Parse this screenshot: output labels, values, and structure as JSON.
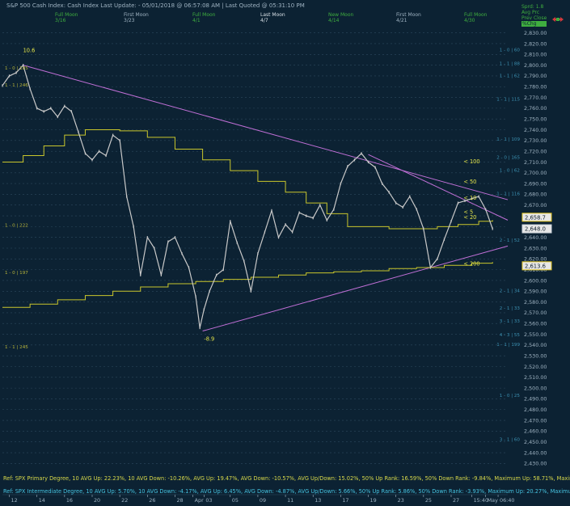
{
  "header": {
    "title": "S&P 500 Cash Index:  Cash Index  Last Update: - 05/01/2018 @ 06:57:08 AM | Last Quoted @ 05:31:10 PM",
    "corner": {
      "line1": "Sprd: 1.8",
      "line2": "Avg Prc",
      "line3": "Prev Close",
      "line4": "%Chg"
    }
  },
  "moon_phases": [
    {
      "label": "Full Moon",
      "date": "3/16",
      "color": "#3fae3f"
    },
    {
      "label": "First Moon",
      "date": "3/23",
      "color": "#9fb3c2"
    },
    {
      "label": "Full Moon",
      "date": "4/1",
      "color": "#3fae3f"
    },
    {
      "label": "Last Moon",
      "date": "4/7",
      "color": "#d8e0e6"
    },
    {
      "label": "New Moon",
      "date": "4/14",
      "color": "#3fae3f"
    },
    {
      "label": "First Moon",
      "date": "4/21",
      "color": "#9fb3c2"
    },
    {
      "label": "Full Moon",
      "date": "4/30",
      "color": "#3fae3f"
    }
  ],
  "chart_data": {
    "type": "line",
    "title": "S&P 500 Cash Index",
    "y_axis": {
      "ylim": [
        2425,
        2835
      ],
      "ticks": [
        "2,830.00",
        "2,820.00",
        "2,810.00",
        "2,800.00",
        "2,790.00",
        "2,780.00",
        "2,770.00",
        "2,760.00",
        "2,750.00",
        "2,740.00",
        "2,730.00",
        "2,720.00",
        "2,710.00",
        "2,700.00",
        "2,690.00",
        "2,680.00",
        "2,670.00",
        "2,660.00",
        "2,650.00",
        "2,640.00",
        "2,630.00",
        "2,620.00",
        "2,610.00",
        "2,600.00",
        "2,590.00",
        "2,580.00",
        "2,570.00",
        "2,560.00",
        "2,550.00",
        "2,540.00",
        "2,530.00",
        "2,520.00",
        "2,510.00",
        "2,500.00",
        "2,490.00",
        "2,480.00",
        "2,470.00",
        "2,460.00",
        "2,450.00",
        "2,440.00",
        "2,430.00"
      ]
    },
    "x_axis": {
      "ticks": [
        {
          "label": "12",
          "x": 0.5
        },
        {
          "label": "14",
          "x": 2.5
        },
        {
          "label": "16",
          "x": 4.5
        },
        {
          "label": "20",
          "x": 6.5
        },
        {
          "label": "22",
          "x": 8.5
        },
        {
          "label": "26",
          "x": 10.5
        },
        {
          "label": "28",
          "x": 12.5
        },
        {
          "label": "Apr",
          "x": 13.8
        },
        {
          "label": "03",
          "x": 14.6
        },
        {
          "label": "05",
          "x": 16.5
        },
        {
          "label": "09",
          "x": 18.5
        },
        {
          "label": "11",
          "x": 20.5
        },
        {
          "label": "13",
          "x": 22.5
        },
        {
          "label": "17",
          "x": 24.5
        },
        {
          "label": "19",
          "x": 26.5
        },
        {
          "label": "23",
          "x": 28.5
        },
        {
          "label": "25",
          "x": 30.5
        },
        {
          "label": "27",
          "x": 32.5
        },
        {
          "label": "15:40",
          "x": 34.0
        },
        {
          "label": "May",
          "x": 35.0
        },
        {
          "label": "06:40",
          "x": 35.9
        }
      ],
      "xlim": [
        0,
        36.6
      ]
    },
    "price_series": [
      [
        0.0,
        2781
      ],
      [
        0.5,
        2790
      ],
      [
        1.0,
        2793
      ],
      [
        1.5,
        2800
      ],
      [
        2.0,
        2778
      ],
      [
        2.5,
        2760
      ],
      [
        3.0,
        2757
      ],
      [
        3.5,
        2760
      ],
      [
        4.0,
        2752
      ],
      [
        4.5,
        2762
      ],
      [
        5.0,
        2757
      ],
      [
        5.5,
        2738
      ],
      [
        6.0,
        2718
      ],
      [
        6.5,
        2712
      ],
      [
        7.0,
        2720
      ],
      [
        7.5,
        2716
      ],
      [
        8.0,
        2735
      ],
      [
        8.5,
        2730
      ],
      [
        9.0,
        2678
      ],
      [
        9.5,
        2650
      ],
      [
        10.0,
        2605
      ],
      [
        10.5,
        2640
      ],
      [
        11.0,
        2630
      ],
      [
        11.5,
        2605
      ],
      [
        12.0,
        2636
      ],
      [
        12.5,
        2640
      ],
      [
        13.0,
        2625
      ],
      [
        13.5,
        2612
      ],
      [
        14.0,
        2585
      ],
      [
        14.3,
        2556
      ],
      [
        14.6,
        2573
      ],
      [
        15.0,
        2590
      ],
      [
        15.5,
        2605
      ],
      [
        16.0,
        2610
      ],
      [
        16.5,
        2655
      ],
      [
        17.0,
        2635
      ],
      [
        17.5,
        2618
      ],
      [
        18.0,
        2590
      ],
      [
        18.5,
        2625
      ],
      [
        19.0,
        2645
      ],
      [
        19.5,
        2665
      ],
      [
        20.0,
        2640
      ],
      [
        20.5,
        2652
      ],
      [
        21.0,
        2645
      ],
      [
        21.5,
        2663
      ],
      [
        22.0,
        2660
      ],
      [
        22.5,
        2658
      ],
      [
        23.0,
        2670
      ],
      [
        23.5,
        2656
      ],
      [
        24.0,
        2666
      ],
      [
        24.5,
        2690
      ],
      [
        25.0,
        2706
      ],
      [
        25.5,
        2712
      ],
      [
        26.0,
        2718
      ],
      [
        26.5,
        2710
      ],
      [
        27.0,
        2705
      ],
      [
        27.5,
        2690
      ],
      [
        28.0,
        2682
      ],
      [
        28.5,
        2672
      ],
      [
        29.0,
        2668
      ],
      [
        29.5,
        2678
      ],
      [
        30.0,
        2666
      ],
      [
        30.5,
        2648
      ],
      [
        31.0,
        2612
      ],
      [
        31.5,
        2620
      ],
      [
        32.0,
        2638
      ],
      [
        32.5,
        2655
      ],
      [
        33.0,
        2672
      ],
      [
        33.5,
        2674
      ],
      [
        34.0,
        2676
      ],
      [
        34.5,
        2678
      ],
      [
        35.0,
        2666
      ],
      [
        35.5,
        2648
      ]
    ],
    "overlays": [
      {
        "name": "upper_trend",
        "color": "#c06fd6",
        "points": [
          [
            1.5,
            2800
          ],
          [
            36.6,
            2675
          ]
        ]
      },
      {
        "name": "lower_trend",
        "color": "#c06fd6",
        "points": [
          [
            14.5,
            2553
          ],
          [
            36.6,
            2632
          ]
        ]
      },
      {
        "name": "inner_trend",
        "color": "#c06fd6",
        "points": [
          [
            26.5,
            2717
          ],
          [
            36.6,
            2656
          ]
        ]
      },
      {
        "name": "ma_step_1",
        "color": "#c9c62c",
        "points": [
          [
            0,
            2710
          ],
          [
            1.5,
            2716
          ],
          [
            3.0,
            2725
          ],
          [
            4.5,
            2735
          ],
          [
            6.0,
            2740
          ],
          [
            8.5,
            2739
          ],
          [
            10.5,
            2733
          ],
          [
            12.5,
            2722
          ],
          [
            14.5,
            2712
          ],
          [
            16.5,
            2702
          ],
          [
            18.5,
            2692
          ],
          [
            20.5,
            2682
          ],
          [
            22.0,
            2672
          ],
          [
            23.5,
            2662
          ],
          [
            25.0,
            2650
          ],
          [
            28.0,
            2648
          ],
          [
            30.0,
            2648
          ],
          [
            31.5,
            2650
          ],
          [
            33.0,
            2652
          ],
          [
            34.5,
            2655
          ],
          [
            35.5,
            2656
          ]
        ]
      },
      {
        "name": "ma_step_2",
        "color": "#c9c62c",
        "points": [
          [
            0,
            2575
          ],
          [
            2.0,
            2578
          ],
          [
            4.0,
            2582
          ],
          [
            6.0,
            2586
          ],
          [
            8.0,
            2590
          ],
          [
            10.0,
            2594
          ],
          [
            12.0,
            2597
          ],
          [
            14.0,
            2599
          ],
          [
            16.0,
            2601
          ],
          [
            18.0,
            2603
          ],
          [
            20.0,
            2605
          ],
          [
            22.0,
            2607
          ],
          [
            24.0,
            2608
          ],
          [
            26.0,
            2609
          ],
          [
            28.0,
            2611
          ],
          [
            30.0,
            2612
          ],
          [
            32.0,
            2614
          ],
          [
            34.0,
            2616
          ],
          [
            35.5,
            2617
          ]
        ]
      }
    ],
    "annotations": [
      {
        "text": "10.6",
        "x": 1.5,
        "y": 2812,
        "color": "#e8e84a"
      },
      {
        "text": "-8.9",
        "x": 14.6,
        "y": 2544,
        "color": "#e8e84a"
      },
      {
        "text": "< 100",
        "x": 33.4,
        "y": 2709,
        "color": "#e8e84a"
      },
      {
        "text": "< 50",
        "x": 33.4,
        "y": 2690,
        "color": "#e8e84a"
      },
      {
        "text": "< 10",
        "x": 33.4,
        "y": 2675,
        "color": "#e8e84a"
      },
      {
        "text": "< 5",
        "x": 33.4,
        "y": 2662,
        "color": "#e8e84a"
      },
      {
        "text": "< 20",
        "x": 33.4,
        "y": 2657,
        "color": "#e8e84a"
      },
      {
        "text": "< 200",
        "x": 33.4,
        "y": 2614,
        "color": "#e8e84a"
      }
    ],
    "level_labels_left": [
      {
        "text": "1 - 0 | 185",
        "y": 2796
      },
      {
        "text": "1 - 1 | 246",
        "y": 2780
      },
      {
        "text": "1 - 0 | 222",
        "y": 2650
      },
      {
        "text": "1 - 0 | 197",
        "y": 2606
      },
      {
        "text": "1 - 1 | 245",
        "y": 2537
      }
    ],
    "level_labels_right": [
      {
        "text": "1 - 0 | 60",
        "y": 2813
      },
      {
        "text": "1 - 1 | 88",
        "y": 2800
      },
      {
        "text": "1 - 1 | 62",
        "y": 2789
      },
      {
        "text": "1 - 1 | 115",
        "y": 2767
      },
      {
        "text": "1 - 1 | 109",
        "y": 2730
      },
      {
        "text": "2 - 0 | 165",
        "y": 2713
      },
      {
        "text": "1 - 0 | 62",
        "y": 2701
      },
      {
        "text": "1 - 1 | 116",
        "y": 2679
      },
      {
        "text": "2 - 1 | 52",
        "y": 2636
      },
      {
        "text": "2 - 1 | 34",
        "y": 2589
      },
      {
        "text": "2 - 1 | 33",
        "y": 2573
      },
      {
        "text": "3 - 1 | 33",
        "y": 2561
      },
      {
        "text": "4 - 3 | 55",
        "y": 2548
      },
      {
        "text": "1 - 1 | 199",
        "y": 2539
      },
      {
        "text": "1 - 0 | 25",
        "y": 2492
      },
      {
        "text": "3 - 1 | 60",
        "y": 2451
      }
    ],
    "price_tags": [
      {
        "text": "2,658.7",
        "y": 2658.7,
        "color": "#e3c623"
      },
      {
        "text": "2,648.0",
        "y": 2648.0,
        "color": "#cfd6dc"
      },
      {
        "text": "2,613.6",
        "y": 2613.6,
        "color": "#e3c623"
      }
    ]
  },
  "footer": {
    "line1": "Ref: SPX Primary Degree, 10 AVG Up: 22.23%, 10 AVG Down: -10.26%, AVG Up: 19.47%, AVG Down: -10.57%, AVG Up/Down: 15.02%, 50%  Up Rank: 16.59%, 50% Down Rank: -9.84%, Maximum Up: 58.71%, Maximum",
    "line2": "Ref: SPX Intermediate Degree, 10 AVG Up: 5.70%, 10 AVG Down: -4.17%, AVG Up: 6.45%, AVG Down: -4.87%, AVG Up/Down: 5.66%, 50%  Up Rank: 5.86%, 50% Down Rank: -3.93%, Maximum Up: 20.27%, Maximum Dc"
  },
  "colors": {
    "background": "#0c2233",
    "grid": "#2d4a5e",
    "price": "#c9c9c9",
    "axis_text": "#9fb3c2"
  }
}
